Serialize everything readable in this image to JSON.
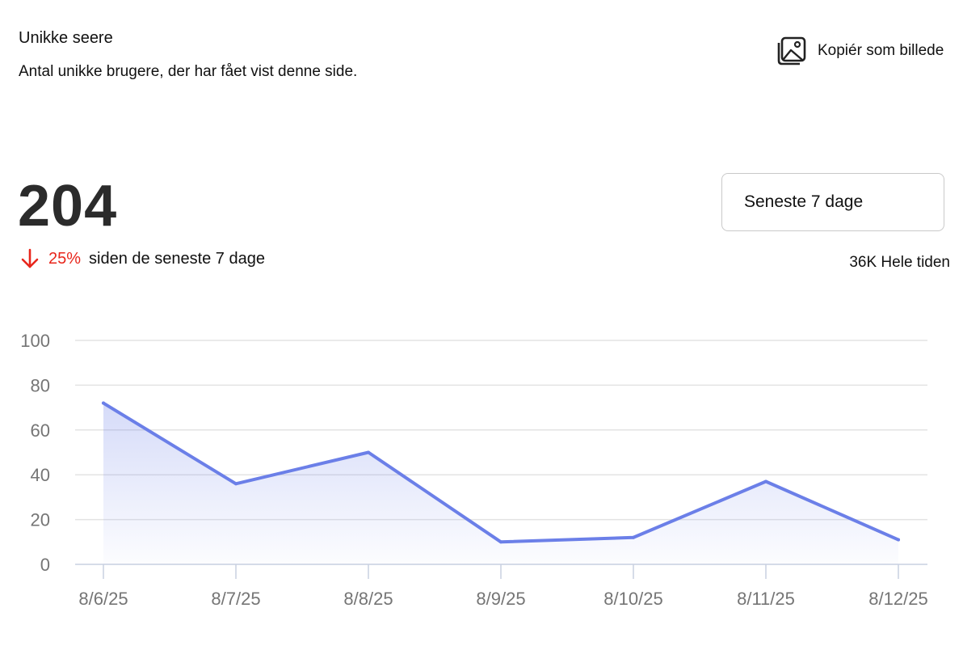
{
  "header": {
    "title": "Unikke seere",
    "subtitle": "Antal unikke brugere, der har fået vist denne side."
  },
  "toolbar": {
    "copy_label": "Kopiér som billede",
    "copy_icon": "image-icon"
  },
  "summary": {
    "value": "204",
    "trend_direction": "down",
    "trend_icon": "arrow-down-icon",
    "trend_percent": "25%",
    "trend_text": "siden de seneste 7 dage",
    "trend_color": "#e8261c",
    "all_time": "36K Hele tiden"
  },
  "range": {
    "selected": "Seneste 7 dage"
  },
  "chart_data": {
    "type": "area",
    "title": "",
    "xlabel": "",
    "ylabel": "",
    "categories": [
      "8/6/25",
      "8/7/25",
      "8/8/25",
      "8/9/25",
      "8/10/25",
      "8/11/25",
      "8/12/25"
    ],
    "series": [
      {
        "values": [
          72,
          36,
          50,
          10,
          12,
          37,
          11
        ],
        "color": "#6b7fe8"
      }
    ],
    "ylim": [
      0,
      100
    ],
    "yticks": [
      0,
      20,
      40,
      60,
      80,
      100
    ],
    "grid": true,
    "legend": "none"
  }
}
